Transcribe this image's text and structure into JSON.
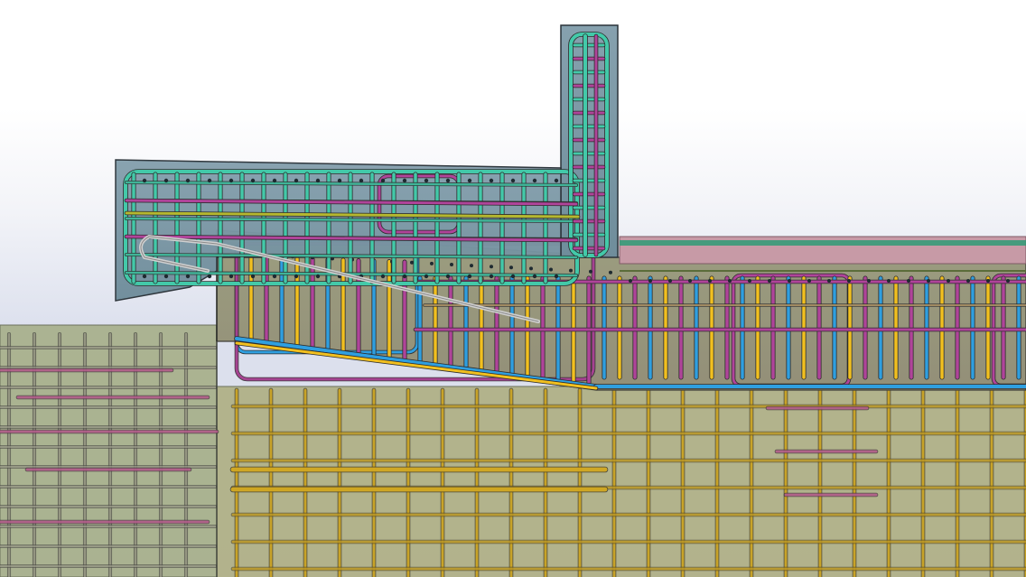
{
  "scene": {
    "kind": "rebar-3d-model",
    "colors": {
      "background_top": "#ffffff",
      "background_bottom": "#d7dbe8",
      "wall_concrete": "#7b98a6",
      "deck_concrete": "#9aa48a",
      "slab_concrete": "#a9aa86",
      "foundation_concrete": "#a7b18a",
      "bar_teal": "#43c9a9",
      "bar_magenta": "#b0449a",
      "bar_blue": "#2f9fe0",
      "bar_yellow": "#f2c01f",
      "bar_grey": "#c9c9c9",
      "bar_pink": "#d96aa5",
      "bar_green": "#2e9b75",
      "outline": "#2a3238"
    },
    "components": [
      {
        "name": "upstand-wall",
        "material": "concrete"
      },
      {
        "name": "cantilever-wall",
        "material": "concrete"
      },
      {
        "name": "deck-slab",
        "material": "concrete"
      },
      {
        "name": "foundation-block",
        "material": "concrete"
      }
    ]
  }
}
